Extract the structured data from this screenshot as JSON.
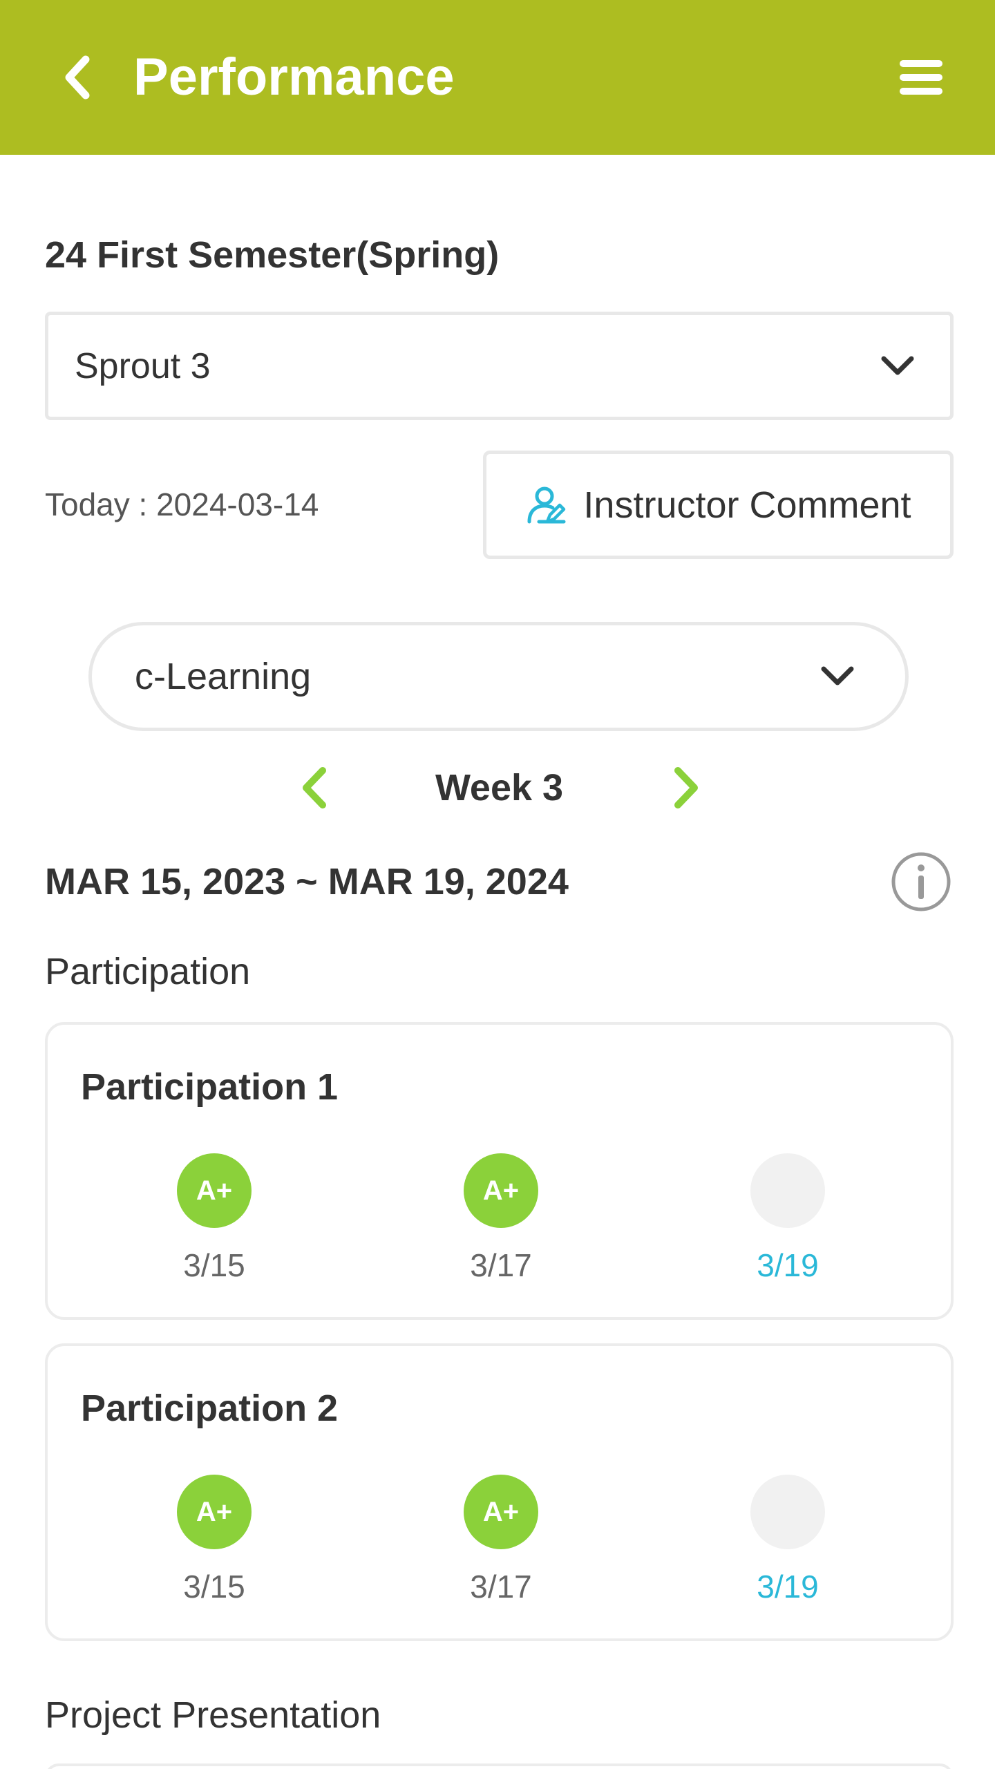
{
  "appbar": {
    "title": "Performance",
    "bg_color": "#adbd21",
    "back_icon": "chevron-left-icon",
    "menu_icon": "hamburger-menu-icon"
  },
  "semester_title": "24 First Semester(Spring)",
  "class_select": {
    "value": "Sprout 3",
    "icon": "chevron-down-icon"
  },
  "today_text": "Today : 2024-03-14",
  "instructor_comment": {
    "label": "Instructor Comment",
    "icon": "user-edit-icon",
    "icon_color": "#2ab8d8"
  },
  "learning_select": {
    "value": "c-Learning",
    "icon": "chevron-down-icon"
  },
  "week_nav": {
    "label": "Week 3",
    "accent_color": "#8bd13a"
  },
  "date_range": "MAR 15, 2023 ~ MAR 19, 2024",
  "info_icon": "info-icon",
  "sections": [
    {
      "label": "Participation",
      "cards": [
        {
          "title": "Participation 1",
          "grades": [
            {
              "grade": "A+",
              "date": "3/15"
            },
            {
              "grade": "A+",
              "date": "3/17"
            },
            {
              "grade": "",
              "date": "3/19"
            }
          ]
        },
        {
          "title": "Participation 2",
          "grades": [
            {
              "grade": "A+",
              "date": "3/15"
            },
            {
              "grade": "A+",
              "date": "3/17"
            },
            {
              "grade": "",
              "date": "3/19"
            }
          ]
        }
      ]
    },
    {
      "label": "Project Presentation",
      "cards": []
    }
  ],
  "colors": {
    "grade_badge": "#8bd13a",
    "empty_badge": "#f1f1f1",
    "current_date": "#2ab8d8"
  }
}
